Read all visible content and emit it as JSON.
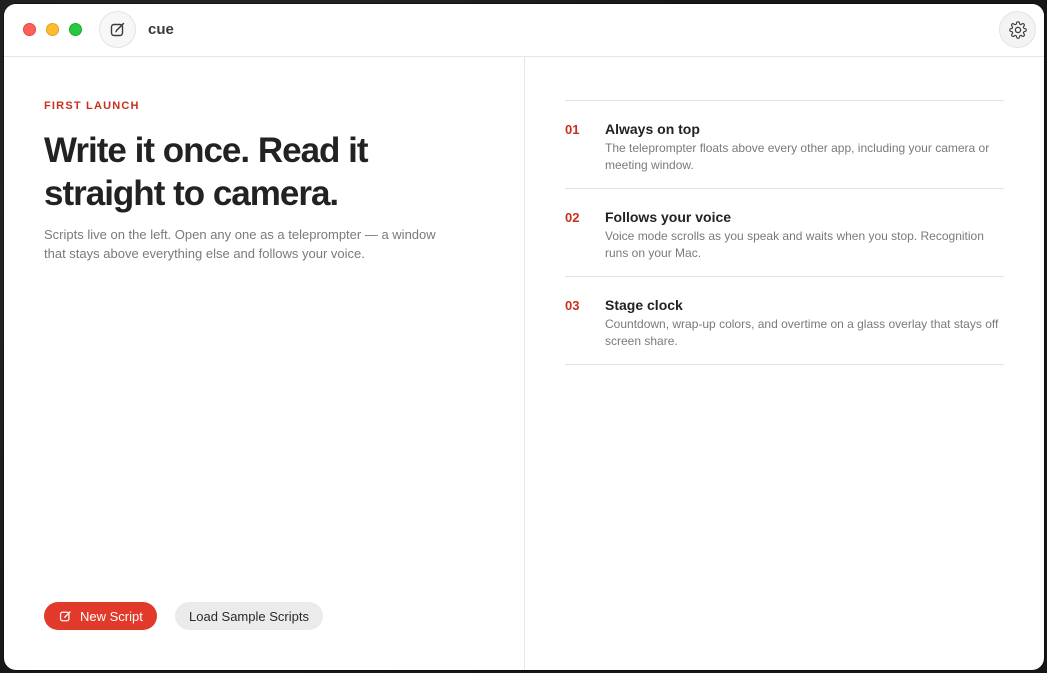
{
  "app": {
    "title": "cue"
  },
  "icons": {
    "compose": "compose-icon",
    "settings": "gear-icon"
  },
  "colors": {
    "accent": "#e2392a",
    "eyebrow": "#c7301f"
  },
  "intro": {
    "eyebrow": "FIRST LAUNCH",
    "headline": "Write it once. Read it straight to camera.",
    "subtext": "Scripts live on the left. Open any one as a teleprompter — a window that stays above everything else and follows your voice."
  },
  "actions": {
    "new_script_label": "New Script",
    "load_samples_label": "Load Sample Scripts"
  },
  "features": [
    {
      "number": "01",
      "title": "Always on top",
      "description": "The teleprompter floats above every other app, including your camera or meeting window."
    },
    {
      "number": "02",
      "title": "Follows your voice",
      "description": "Voice mode scrolls as you speak and waits when you stop. Recognition runs on your Mac."
    },
    {
      "number": "03",
      "title": "Stage clock",
      "description": "Countdown, wrap-up colors, and overtime on a glass overlay that stays off screen share."
    }
  ]
}
